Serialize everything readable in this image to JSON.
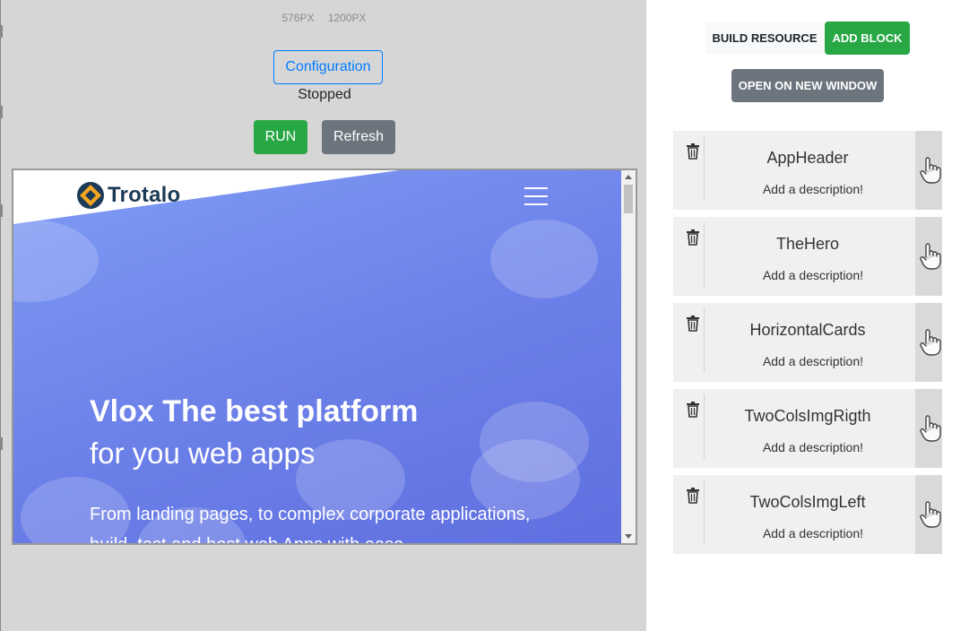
{
  "viewport_sizes": [
    "576PX",
    "1200PX"
  ],
  "toolbar": {
    "configuration_label": "Configuration",
    "status": "Stopped",
    "run_label": "RUN",
    "refresh_label": "Refresh"
  },
  "preview": {
    "brand_name": "Trotalo",
    "hero_title": "Vlox The best platform",
    "hero_subtitle": "for you web apps",
    "hero_text": "From landing pages, to complex corporate applications, build, test and host web Apps with ease"
  },
  "side_panel": {
    "build_resource_label": "BUILD RESOURCE",
    "add_block_label": "ADD BLOCK",
    "open_window_label": "OPEN ON NEW WINDOW"
  },
  "blocks": [
    {
      "name": "AppHeader",
      "description": "Add a description!"
    },
    {
      "name": "TheHero",
      "description": "Add a description!"
    },
    {
      "name": "HorizontalCards",
      "description": "Add a description!"
    },
    {
      "name": "TwoColsImgRigth",
      "description": "Add a description!"
    },
    {
      "name": "TwoColsImgLeft",
      "description": "Add a description!"
    }
  ],
  "colors": {
    "success": "#28a745",
    "secondary": "#6c757d",
    "primary": "#007bff",
    "hero_gradient": "#7f9cf5"
  },
  "icons": {
    "block_delete": "trash-icon",
    "block_drag": "hand-pointer-icon",
    "menu": "hamburger-icon"
  }
}
